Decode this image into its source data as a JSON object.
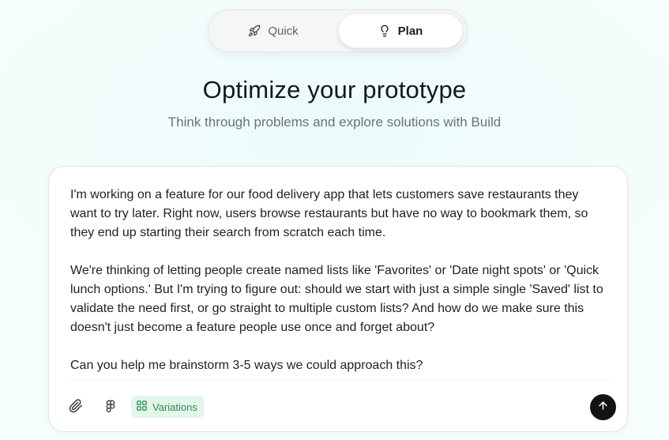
{
  "mode_toggle": {
    "options": [
      {
        "label": "Quick",
        "icon": "rocket-icon",
        "selected": false
      },
      {
        "label": "Plan",
        "icon": "lightbulb-icon",
        "selected": true
      }
    ]
  },
  "heading": {
    "title": "Optimize your prototype",
    "subtitle": "Think through problems and explore solutions with Build"
  },
  "prompt": {
    "paragraphs": [
      "I'm working on a feature for our food delivery app that lets customers save restaurants they want to try later. Right now, users browse restaurants but have no way to bookmark them, so they end up starting their search from scratch each time.",
      "We're thinking of letting people create named lists like 'Favorites' or 'Date night spots' or 'Quick lunch options.' But I'm trying to figure out: should we start with just a simple single 'Saved' list to validate the need first, or go straight to multiple custom lists? And how do we make sure this doesn't just become a feature people use once and forget about?",
      "Can you help me brainstorm 3-5 ways we could approach this?"
    ]
  },
  "toolbar": {
    "attach_icon": "paperclip-icon",
    "figma_icon": "figma-icon",
    "variations_label": "Variations",
    "variations_icon": "grid-icon",
    "send_icon": "arrow-up-icon"
  },
  "colors": {
    "accent_green": "#2f8a55",
    "accent_green_bg": "#e2f6ea",
    "send_button": "#111315"
  }
}
